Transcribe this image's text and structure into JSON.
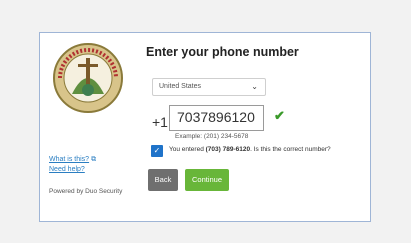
{
  "sidebar": {
    "logo_icon": "county-seal-logo",
    "what_is_this": "What is this?",
    "need_help": "Need help?",
    "powered_by": "Powered by Duo Security"
  },
  "main": {
    "title": "Enter your phone number",
    "country_selected": "United States",
    "phone_prefix": "+1",
    "phone_value": "7037896120",
    "example": "Example: (201) 234-5678",
    "confirm_text_before": "You entered ",
    "confirm_number": "(703) 789-6120",
    "confirm_text_after": ". Is this the correct number?",
    "back_label": "Back",
    "continue_label": "Continue"
  },
  "colors": {
    "accent_blue": "#1f73c9",
    "link_blue": "#2a7ec2",
    "continue_green": "#68b639",
    "back_gray": "#6f6f6f",
    "check_green": "#3a9a2a"
  }
}
